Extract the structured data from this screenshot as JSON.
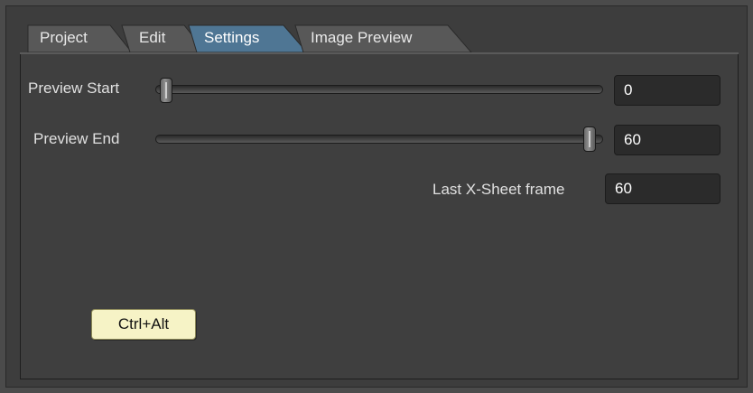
{
  "tabs": [
    {
      "label": "Project",
      "active": false
    },
    {
      "label": "Edit",
      "active": false
    },
    {
      "label": "Settings",
      "active": true
    },
    {
      "label": "Image Preview",
      "active": false
    }
  ],
  "preview_start": {
    "label": "Preview Start",
    "value": "0",
    "level": 0
  },
  "preview_end": {
    "label": "Preview End",
    "value": "60",
    "level": 1
  },
  "last_xsheet": {
    "label": "Last X-Sheet frame",
    "value": "60"
  },
  "tooltip": {
    "text": "Ctrl+Alt"
  },
  "colors": {
    "active_tab": "#4f7694",
    "inactive_tab": "#585858",
    "panel_bg": "#3f3f3f",
    "field_bg": "#2b2b2b",
    "tooltip_bg": "#f6f3c6"
  }
}
